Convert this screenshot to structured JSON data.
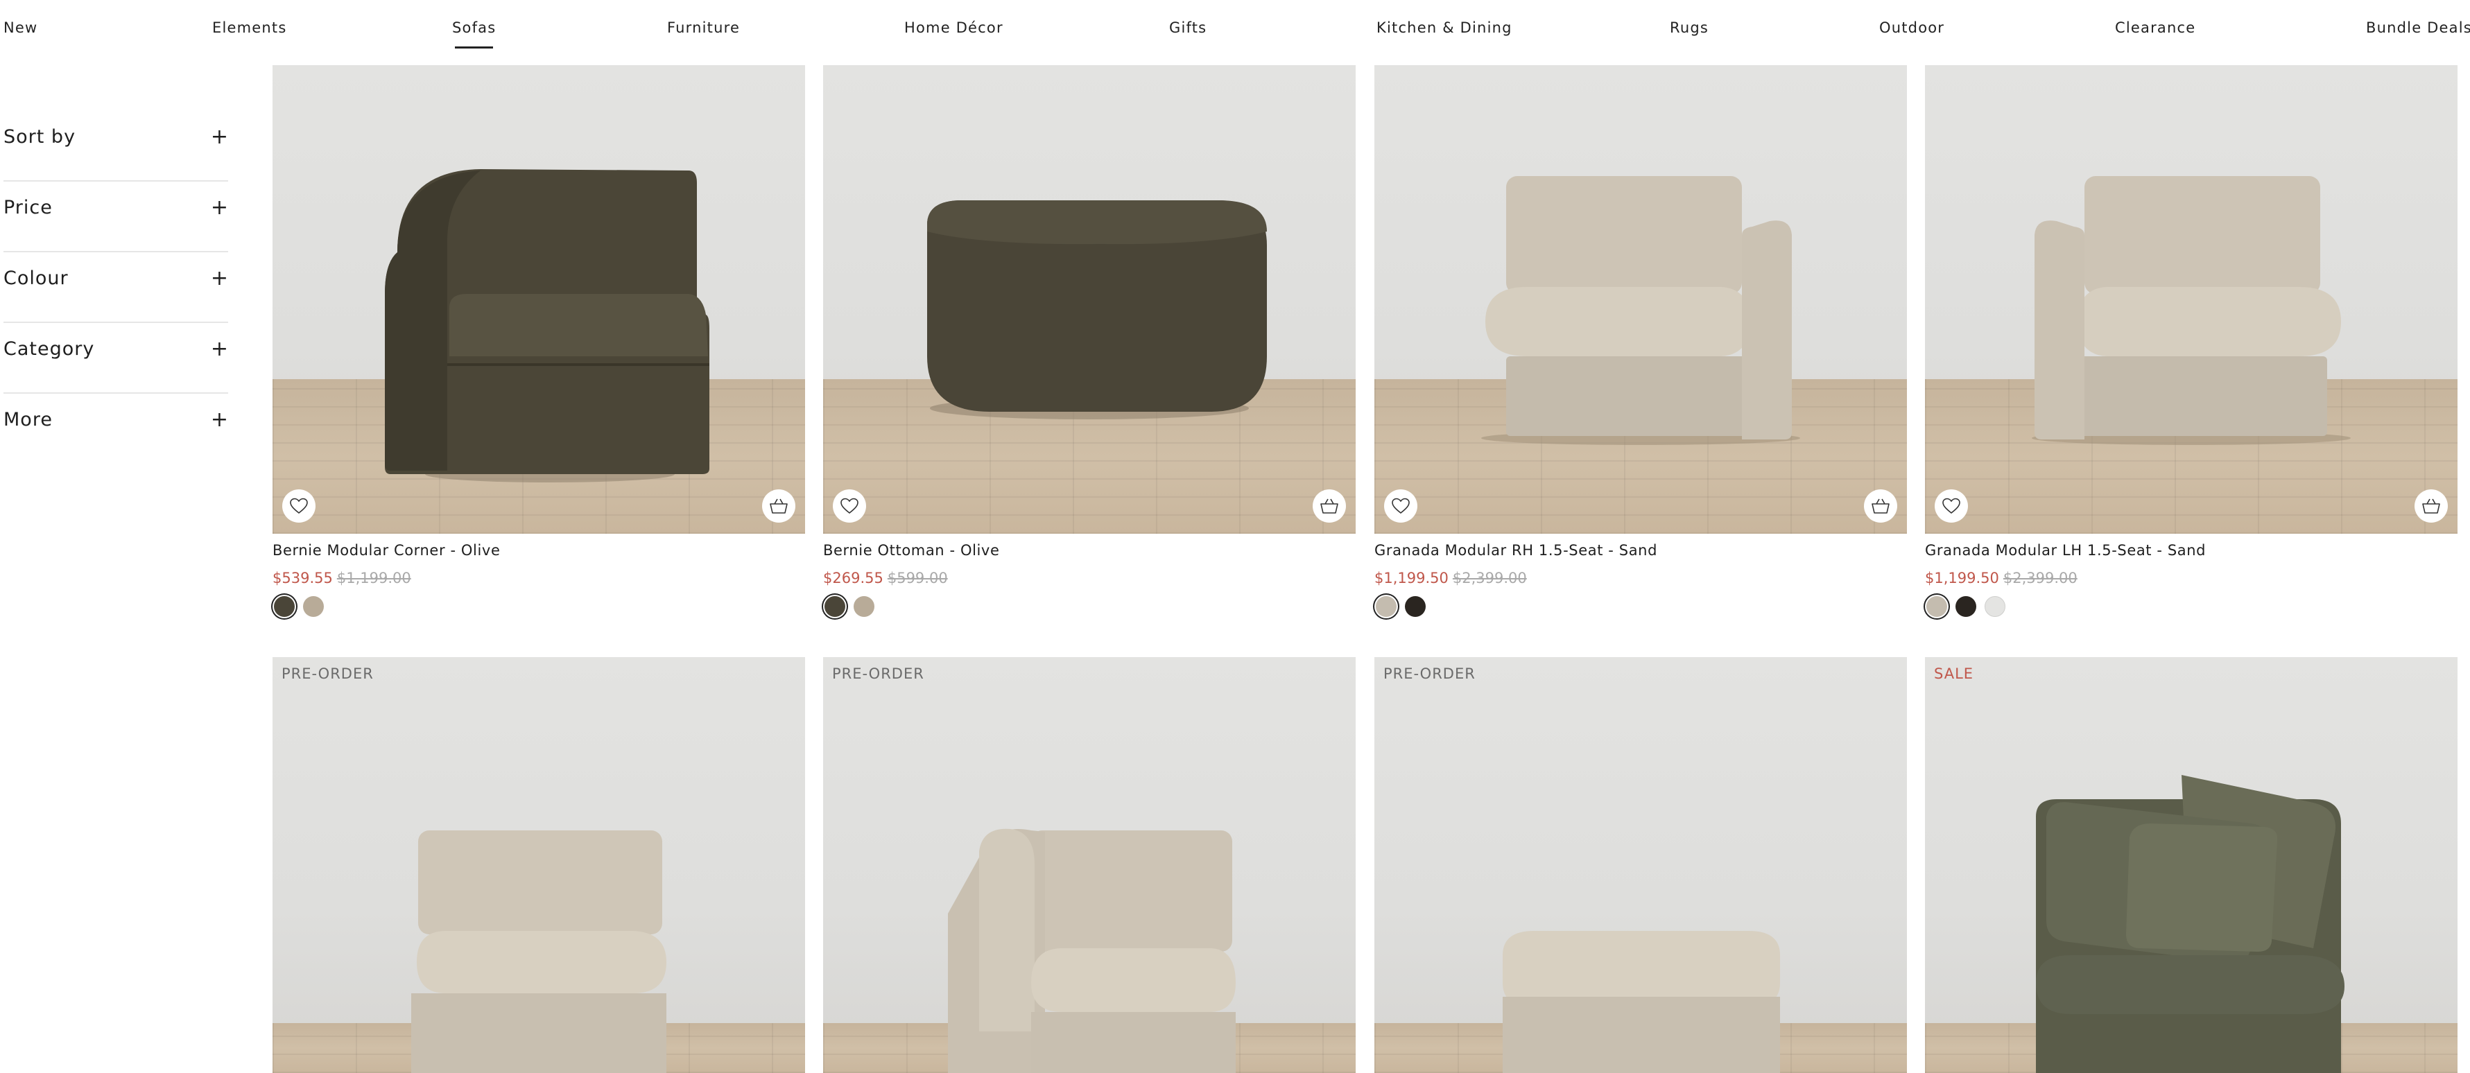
{
  "nav": {
    "items": [
      {
        "label": "New"
      },
      {
        "label": "Elements"
      },
      {
        "label": "Sofas",
        "active": true
      },
      {
        "label": "Furniture"
      },
      {
        "label": "Home Décor"
      },
      {
        "label": "Gifts"
      },
      {
        "label": "Kitchen & Dining"
      },
      {
        "label": "Rugs"
      },
      {
        "label": "Outdoor"
      },
      {
        "label": "Clearance"
      },
      {
        "label": "Bundle Deals"
      }
    ]
  },
  "filters": [
    {
      "label": "Sort by",
      "icon": "+"
    },
    {
      "label": "Price",
      "icon": "+"
    },
    {
      "label": "Colour",
      "icon": "+"
    },
    {
      "label": "Category",
      "icon": "+"
    },
    {
      "label": "More",
      "icon": "+"
    }
  ],
  "products": [
    {
      "name": "Bernie Modular Corner - Olive",
      "price": "$539.55",
      "was": "$1,199.00",
      "swatches": [
        "#4a4538",
        "#b8ab98"
      ]
    },
    {
      "name": "Bernie Ottoman - Olive",
      "price": "$269.55",
      "was": "$599.00",
      "swatches": [
        "#4a4538",
        "#b8ab98"
      ]
    },
    {
      "name": "Granada Modular RH 1.5-Seat - Sand",
      "price": "$1,199.50",
      "was": "$2,399.00",
      "swatches": [
        "#c4bcaf",
        "#2a2520"
      ]
    },
    {
      "name": "Granada Modular LH 1.5-Seat - Sand",
      "price": "$1,199.50",
      "was": "$2,399.00",
      "swatches": [
        "#c4bcaf",
        "#2a2520",
        "#e4e4e2"
      ]
    },
    {
      "badge": "PRE-ORDER"
    },
    {
      "badge": "PRE-ORDER"
    },
    {
      "badge": "PRE-ORDER"
    },
    {
      "badge": "SALE"
    }
  ],
  "colors": {
    "sale": "#c0574b",
    "text": "#1e1e1e",
    "strike": "#a9a9a9"
  },
  "icons": {
    "wishlist": "heart-icon",
    "cart": "basket-icon",
    "expand": "plus-icon"
  }
}
